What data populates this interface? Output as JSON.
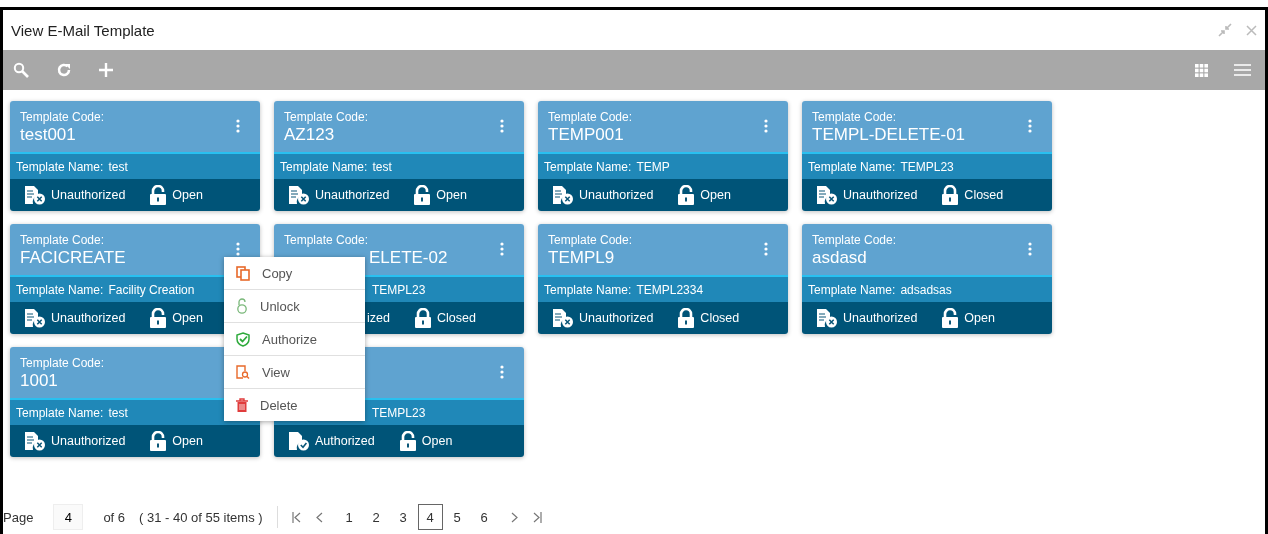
{
  "window": {
    "title": "View E-Mail Template"
  },
  "cards": [
    {
      "overlapped": false,
      "more_button": true,
      "code_label": "Template Code:",
      "code": "test001",
      "name_label": "Template Name:",
      "name": "test",
      "authorized": false,
      "auth_text": "Unauthorized",
      "locked": false,
      "lock_text": "Open"
    },
    {
      "overlapped": false,
      "more_button": true,
      "code_label": "Template Code:",
      "code": "AZ123",
      "name_label": "Template Name:",
      "name": "test",
      "authorized": false,
      "auth_text": "Unauthorized",
      "locked": false,
      "lock_text": "Open"
    },
    {
      "overlapped": false,
      "more_button": true,
      "code_label": "Template Code:",
      "code": "TEMP001",
      "name_label": "Template Name:",
      "name": "TEMP",
      "authorized": false,
      "auth_text": "Unauthorized",
      "locked": false,
      "lock_text": "Open"
    },
    {
      "overlapped": false,
      "more_button": true,
      "code_label": "Template Code:",
      "code": "TEMPL-DELETE-01",
      "name_label": "Template Name:",
      "name": "TEMPL23",
      "authorized": false,
      "auth_text": "Unauthorized",
      "locked": true,
      "lock_text": "Closed"
    },
    {
      "overlapped": false,
      "more_button": true,
      "code_label": "Template Code:",
      "code": "FACICREATE",
      "name_label": "Template Name:",
      "name": "Facility Creation",
      "authorized": false,
      "auth_text": "Unauthorized",
      "locked": false,
      "lock_text": "Open"
    },
    {
      "overlapped": true,
      "more_button": true,
      "code_label": "Template Code:",
      "code": "ELETE-02",
      "name": "TEMPL23",
      "auth_text": "ized",
      "locked": true,
      "lock_text": "Closed"
    },
    {
      "overlapped": false,
      "more_button": true,
      "code_label": "Template Code:",
      "code": "TEMPL9",
      "name_label": "Template Name:",
      "name": "TEMPL2334",
      "authorized": false,
      "auth_text": "Unauthorized",
      "locked": true,
      "lock_text": "Closed"
    },
    {
      "overlapped": false,
      "more_button": true,
      "code_label": "Template Code:",
      "code": "asdasd",
      "name_label": "Template Name:",
      "name": "adsadsas",
      "authorized": false,
      "auth_text": "Unauthorized",
      "locked": false,
      "lock_text": "Open"
    },
    {
      "overlapped": false,
      "more_button": false,
      "code_label": "Template Code:",
      "code": "1001",
      "name_label": "Template Name:",
      "name": "test",
      "authorized": false,
      "auth_text": "Unauthorized",
      "locked": false,
      "lock_text": "Open"
    },
    {
      "overlapped": true,
      "more_button": true,
      "name": "TEMPL23",
      "authorized": true,
      "auth_text": "Authorized",
      "locked": false,
      "lock_text": "Open"
    }
  ],
  "menu": {
    "items": [
      {
        "kind": "copy",
        "label": "Copy"
      },
      {
        "kind": "unlock",
        "label": "Unlock"
      },
      {
        "kind": "authorize",
        "label": "Authorize"
      },
      {
        "kind": "view",
        "label": "View"
      },
      {
        "kind": "delete",
        "label": "Delete"
      }
    ]
  },
  "pagination": {
    "page_label": "Page",
    "page_value": "4",
    "of_pages": "of 6",
    "range": "( 31 - 40 of 55 items )",
    "pages": [
      {
        "label": "1",
        "selected": false
      },
      {
        "label": "2",
        "selected": false
      },
      {
        "label": "3",
        "selected": false
      },
      {
        "label": "4",
        "selected": true
      },
      {
        "label": "5",
        "selected": false
      },
      {
        "label": "6",
        "selected": false
      }
    ]
  }
}
